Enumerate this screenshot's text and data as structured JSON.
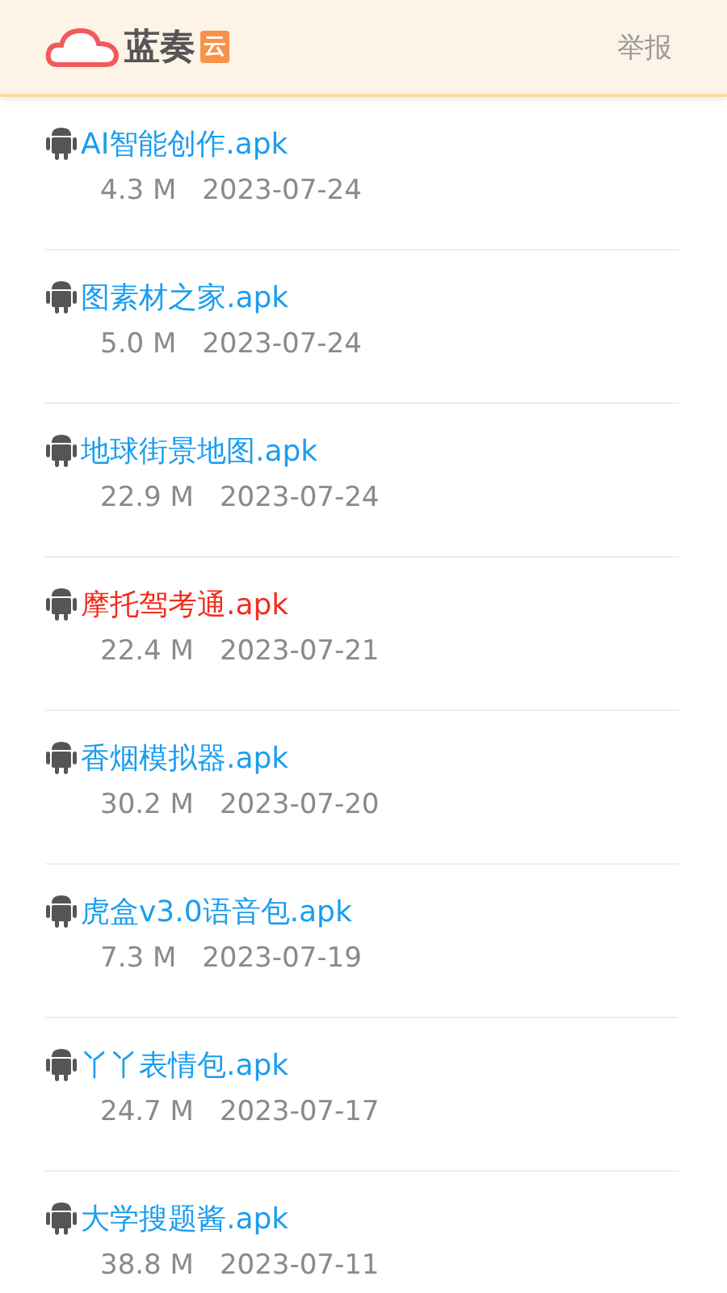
{
  "header": {
    "logo_text": "蓝奏",
    "logo_badge": "云",
    "report": "举报"
  },
  "files": [
    {
      "name": "AI智能创作.apk",
      "size": "4.3 M",
      "date": "2023-07-24",
      "highlighted": false
    },
    {
      "name": "图素材之家.apk",
      "size": "5.0 M",
      "date": "2023-07-24",
      "highlighted": false
    },
    {
      "name": "地球街景地图.apk",
      "size": "22.9 M",
      "date": "2023-07-24",
      "highlighted": false
    },
    {
      "name": "摩托驾考通.apk",
      "size": "22.4 M",
      "date": "2023-07-21",
      "highlighted": true
    },
    {
      "name": "香烟模拟器.apk",
      "size": "30.2 M",
      "date": "2023-07-20",
      "highlighted": false
    },
    {
      "name": "虎盒v3.0语音包.apk",
      "size": "7.3 M",
      "date": "2023-07-19",
      "highlighted": false
    },
    {
      "name": "丫丫表情包.apk",
      "size": "24.7 M",
      "date": "2023-07-17",
      "highlighted": false
    },
    {
      "name": "大学搜题酱.apk",
      "size": "38.8 M",
      "date": "2023-07-11",
      "highlighted": false
    }
  ]
}
